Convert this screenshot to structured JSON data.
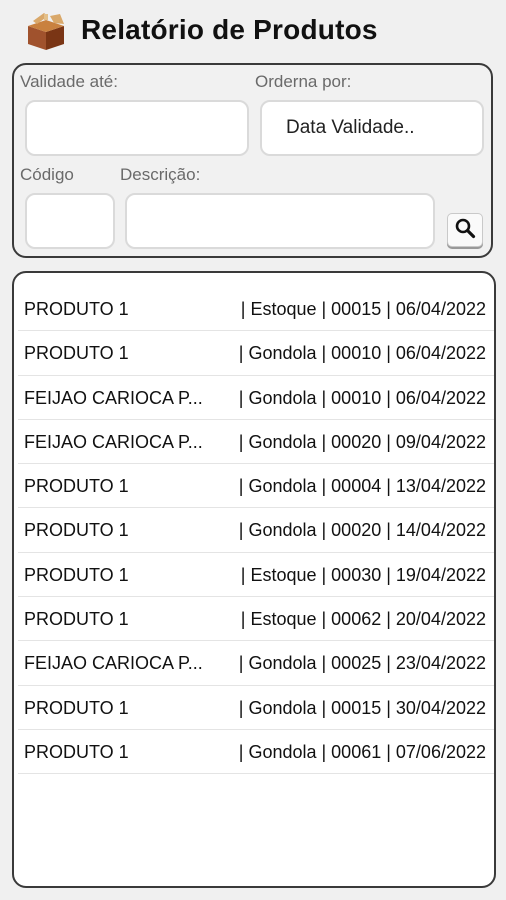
{
  "header": {
    "title": "Relatório de Produtos",
    "logo": "box-icon"
  },
  "filters": {
    "validade_label": "Validade até:",
    "validade_value": "",
    "ordena_label": "Orderna por:",
    "ordena_value": "Data Validade..",
    "codigo_label": "Código",
    "codigo_value": "",
    "descricao_label": "Descrição:",
    "descricao_value": "",
    "search_icon": "search-icon"
  },
  "products": [
    {
      "name": "PRODUTO 1",
      "info": "| Estoque | 00015 | 06/04/2022"
    },
    {
      "name": "PRODUTO 1",
      "info": "| Gondola | 00010 | 06/04/2022"
    },
    {
      "name": "FEIJAO CARIOCA P...",
      "info": "| Gondola | 00010 | 06/04/2022"
    },
    {
      "name": "FEIJAO CARIOCA P...",
      "info": "| Gondola | 00020 | 09/04/2022"
    },
    {
      "name": "PRODUTO 1",
      "info": "| Gondola | 00004 | 13/04/2022"
    },
    {
      "name": "PRODUTO 1",
      "info": "| Gondola | 00020 | 14/04/2022"
    },
    {
      "name": "PRODUTO 1",
      "info": "| Estoque | 00030 | 19/04/2022"
    },
    {
      "name": "PRODUTO 1",
      "info": "| Estoque | 00062 | 20/04/2022"
    },
    {
      "name": "FEIJAO CARIOCA P...",
      "info": "| Gondola | 00025 | 23/04/2022"
    },
    {
      "name": "PRODUTO 1",
      "info": "| Gondola | 00015 | 30/04/2022"
    },
    {
      "name": "PRODUTO 1",
      "info": "| Gondola | 00061 | 07/06/2022"
    }
  ]
}
